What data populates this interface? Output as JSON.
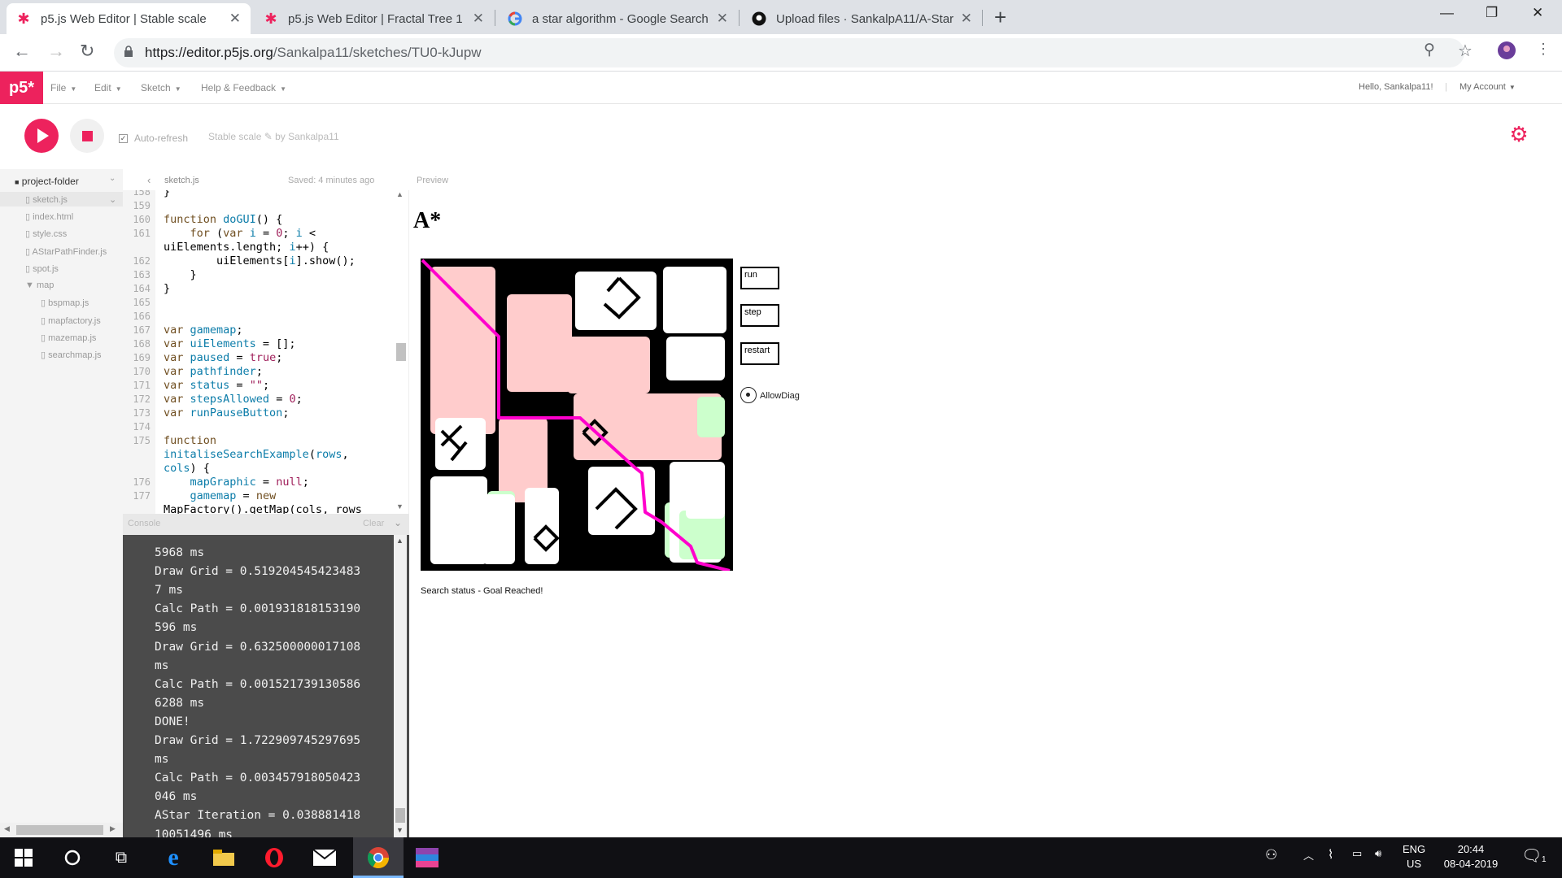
{
  "browser": {
    "tabs": [
      {
        "title": "p5.js Web Editor | Stable scale",
        "icon": "p5-asterisk-icon"
      },
      {
        "title": "p5.js Web Editor | Fractal Tree 1",
        "icon": "p5-asterisk-icon"
      },
      {
        "title": "a star algorithm - Google Search",
        "icon": "google-icon"
      },
      {
        "title": "Upload files · SankalpA11/A-Star",
        "icon": "github-icon"
      }
    ],
    "url_prefix": "https://editor.p5js.org",
    "url_path": "/Sankalpa11/sketches/TU0-kJupw"
  },
  "p5nav": {
    "logo": "p5*",
    "menu": [
      "File",
      "Edit",
      "Sketch",
      "Help & Feedback"
    ],
    "greeting": "Hello, Sankalpa11!",
    "account": "My Account"
  },
  "controls": {
    "auto_refresh": "Auto-refresh",
    "sketch_name": "Stable scale",
    "by": "by Sankalpa11"
  },
  "sidebar": {
    "folder": "project-folder",
    "files": [
      "sketch.js",
      "index.html",
      "style.css",
      "AStarPathFinder.js",
      "spot.js",
      "map",
      "bspmap.js",
      "mapfactory.js",
      "mazemap.js",
      "searchmap.js"
    ]
  },
  "editor": {
    "filename": "sketch.js",
    "saved": "Saved: 4 minutes ago"
  },
  "console": {
    "title": "Console",
    "clear": "Clear",
    "lines": [
      "5968 ms",
      "Draw Grid = 0.519204545423483",
      "7 ms",
      "Calc Path = 0.001931818153190",
      "596 ms",
      "Draw Grid = 0.632500000017108",
      "ms",
      "Calc Path = 0.001521739130586",
      "6288 ms",
      "DONE!",
      "Draw Grid = 1.722909745297695",
      "ms",
      "Calc Path = 0.003457918050423",
      "046 ms",
      "AStar Iteration = 0.038881418",
      "10051496 ms"
    ]
  },
  "preview": {
    "label": "Preview",
    "title": "A*",
    "buttons": [
      "run",
      "step",
      "restart"
    ],
    "radio_label": "AllowDiag",
    "status": "Search status - Goal Reached!"
  },
  "taskbar": {
    "lang1": "ENG",
    "lang2": "US",
    "time": "20:44",
    "date": "08-04-2019",
    "notif_count": "1"
  },
  "colors": {
    "accent": "#ed225d",
    "path": "#ff00cc",
    "closed": "#ffcccc",
    "open": "#ccffcc"
  }
}
